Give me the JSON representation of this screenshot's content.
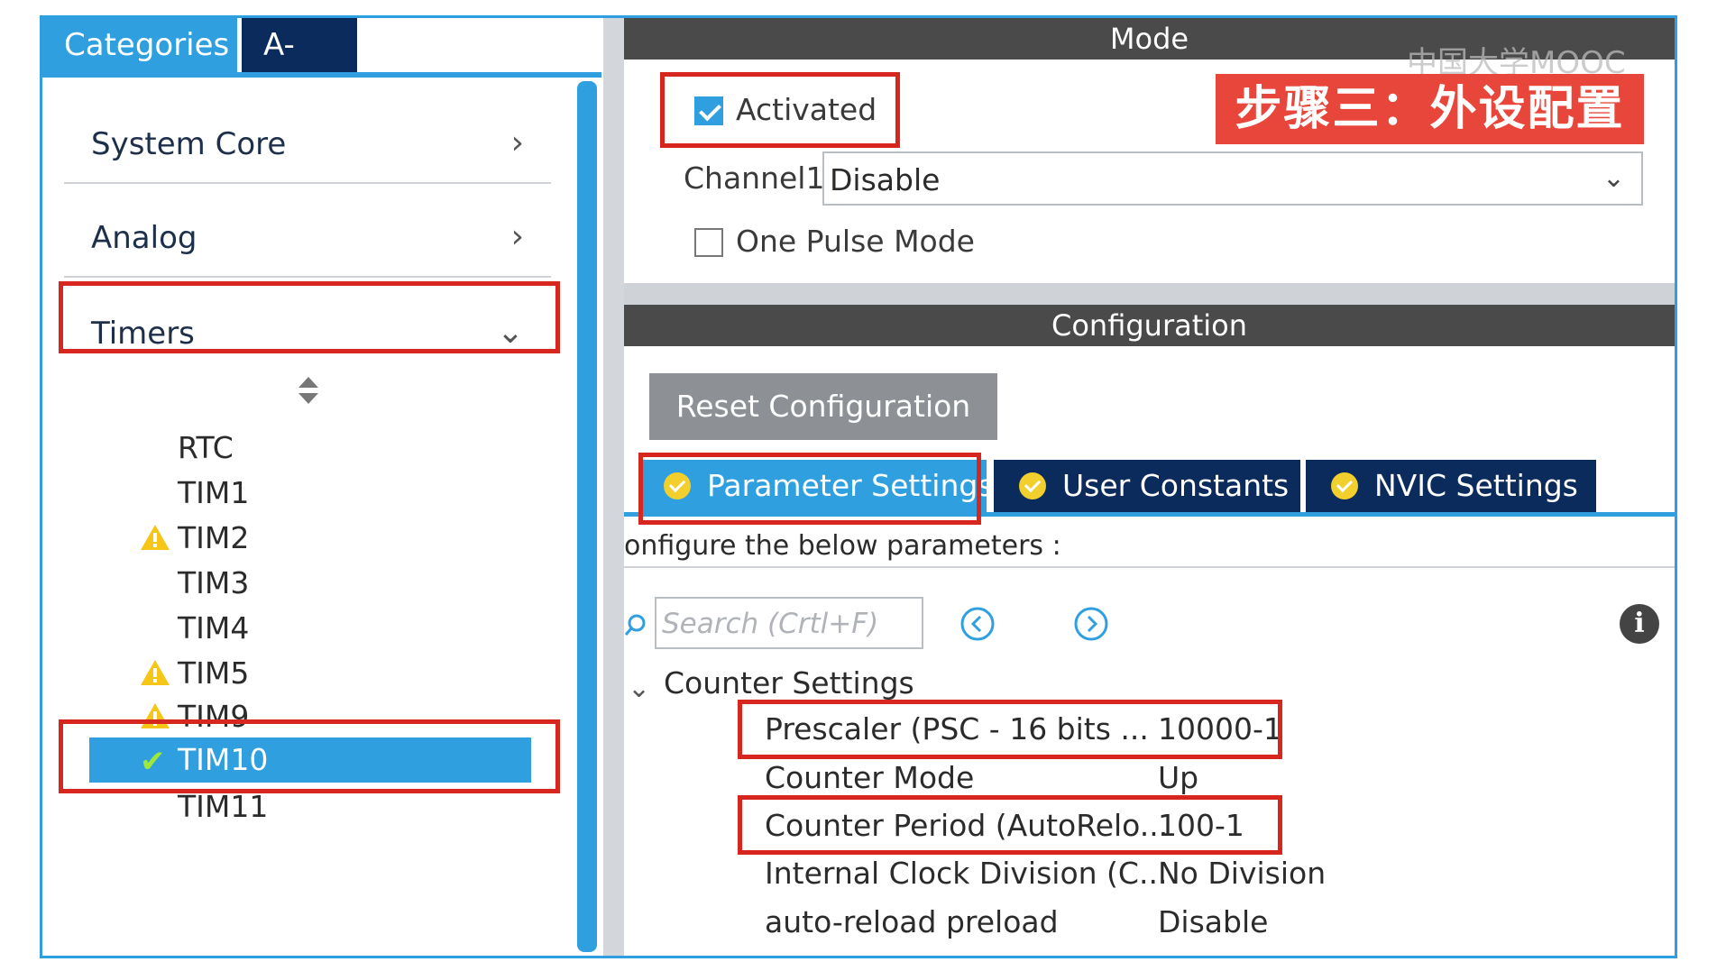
{
  "left_tabs": {
    "categories": "Categories",
    "az": "A->Z"
  },
  "categories": [
    {
      "label": "System Core",
      "chevron": "›"
    },
    {
      "label": "Analog",
      "chevron": "›"
    },
    {
      "label": "Timers",
      "chevron": "⌄"
    }
  ],
  "timers": [
    {
      "name": "RTC",
      "status": "none"
    },
    {
      "name": "TIM1",
      "status": "none"
    },
    {
      "name": "TIM2",
      "status": "warning"
    },
    {
      "name": "TIM3",
      "status": "none"
    },
    {
      "name": "TIM4",
      "status": "none"
    },
    {
      "name": "TIM5",
      "status": "warning"
    },
    {
      "name": "TIM9",
      "status": "warning"
    },
    {
      "name": "TIM10",
      "status": "ok",
      "selected": true
    },
    {
      "name": "TIM11",
      "status": "none"
    }
  ],
  "mode": {
    "title": "Mode",
    "activated_label": "Activated",
    "activated": true,
    "channel_label": "Channel1",
    "channel_value": "Disable",
    "one_pulse_label": "One Pulse Mode",
    "one_pulse": false
  },
  "overlay": {
    "stamp": "步骤三：外设配置",
    "watermark": "中国大学MOOC"
  },
  "configuration": {
    "title": "Configuration",
    "reset_label": "Reset Configuration",
    "tabs": [
      "Parameter Settings",
      "User Constants",
      "NVIC Settings"
    ],
    "instruction": "onfigure the below parameters :",
    "search_placeholder": "Search (Crtl+F)",
    "group": "Counter Settings",
    "params": [
      {
        "name": "Prescaler (PSC - 16 bits ...",
        "value": "10000-1"
      },
      {
        "name": "Counter Mode",
        "value": "Up"
      },
      {
        "name": "Counter Period (AutoRelo...",
        "value": "100-1"
      },
      {
        "name": "Internal Clock Division (C...",
        "value": "No Division"
      },
      {
        "name": "auto-reload preload",
        "value": "Disable"
      }
    ]
  },
  "colors": {
    "accent": "#2f9fe0",
    "navy": "#0b2b5c",
    "highlight": "#d7261e",
    "stamp": "#e8453b"
  }
}
